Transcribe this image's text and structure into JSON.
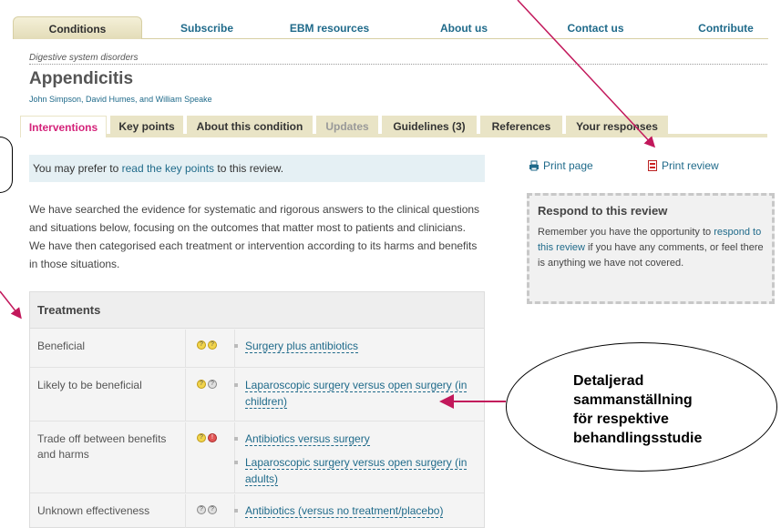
{
  "nav": {
    "items": [
      "Conditions",
      "Subscribe",
      "EBM resources",
      "About us",
      "Contact us",
      "Contribute"
    ]
  },
  "breadcrumb": "Digestive system disorders",
  "title": "Appendicitis",
  "authors": "John Simpson, David Humes, and William Speake",
  "tabs": [
    "Interventions",
    "Key points",
    "About this condition",
    "Updates",
    "Guidelines (3)",
    "References",
    "Your responses"
  ],
  "notice": {
    "prefix": "You may prefer to ",
    "link": "read the key points",
    "suffix": " to this review."
  },
  "intro": "We have searched the evidence for systematic and rigorous answers to the clinical questions and situations below, focusing on the outcomes that matter most to patients and clinicians. We have then categorised each treatment or intervention according to its harms and benefits in those situations.",
  "treatments": {
    "header": "Treatments",
    "rows": [
      {
        "category": "Beneficial",
        "items": [
          "Surgery plus antibiotics"
        ]
      },
      {
        "category": "Likely to be beneficial",
        "items": [
          "Laparoscopic surgery versus open surgery (in children)"
        ]
      },
      {
        "category": "Trade off between benefits and harms",
        "items": [
          "Antibiotics versus surgery",
          "Laparoscopic surgery versus open surgery (in adults)"
        ]
      },
      {
        "category": "Unknown effectiveness",
        "items": [
          "Antibiotics (versus no treatment/placebo)"
        ]
      }
    ]
  },
  "print": {
    "page": "Print page",
    "review": "Print review"
  },
  "respond": {
    "title": "Respond to this review",
    "text_before": "Remember you have the opportunity to ",
    "link": "respond to this review",
    "text_after": " if you have any comments, or feel there is anything we have not covered."
  },
  "callout": {
    "lines": [
      "Detaljerad",
      "sammanställning",
      "för respektive",
      "behandlingsstudie"
    ]
  },
  "colors": {
    "accent": "#d4237a",
    "link": "#1f6a8a",
    "annotation_arrow": "#c2185b"
  }
}
